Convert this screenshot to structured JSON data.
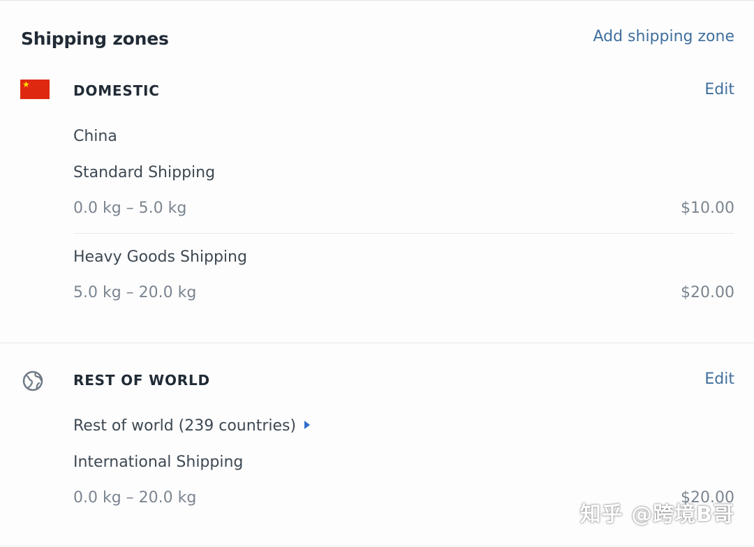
{
  "header": {
    "title": "Shipping zones",
    "add_zone_label": "Add shipping zone"
  },
  "zones": [
    {
      "name": "DOMESTIC",
      "icon": "china-flag-icon",
      "edit_label": "Edit",
      "country": "China",
      "rates": [
        {
          "name": "Standard Shipping",
          "range": "0.0 kg – 5.0 kg",
          "price": "$10.00"
        },
        {
          "name": "Heavy Goods Shipping",
          "range": "5.0 kg – 20.0 kg",
          "price": "$20.00"
        }
      ]
    },
    {
      "name": "REST OF WORLD",
      "icon": "globe-icon",
      "edit_label": "Edit",
      "country": "Rest of world (239 countries)",
      "rates": [
        {
          "name": "International Shipping",
          "range": "0.0 kg – 20.0 kg",
          "price": "$20.00"
        }
      ]
    }
  ],
  "watermark": "知乎 @跨境B哥",
  "colors": {
    "link": "#3f6f9e",
    "flag_red": "#de2910",
    "flag_star": "#ffde00",
    "expand_arrow": "#2c6ecb"
  }
}
